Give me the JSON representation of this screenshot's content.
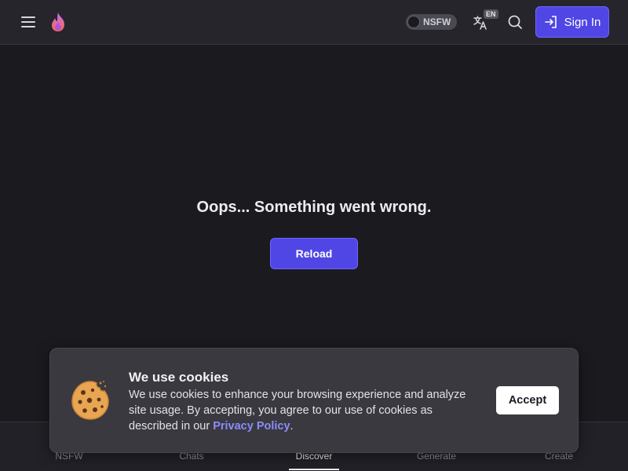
{
  "header": {
    "menu_icon": "hamburger-icon",
    "logo_icon": "flame-icon",
    "nsfw_toggle_label": "NSFW",
    "nsfw_enabled": false,
    "language_badge": "EN",
    "signin_label": "Sign In",
    "colors": {
      "accent": "#4f46e5",
      "background": "#26252b"
    }
  },
  "main": {
    "error_message": "Oops... Something went wrong.",
    "reload_label": "Reload"
  },
  "bottom_nav": {
    "items": [
      {
        "label": "NSFW"
      },
      {
        "label": "Chats"
      },
      {
        "label": "Discover",
        "active": true
      },
      {
        "label": "Generate"
      },
      {
        "label": "Create"
      }
    ]
  },
  "cookie_banner": {
    "title": "We use cookies",
    "text_before_link": "We use cookies to enhance your browsing experience and analyze site usage. By accepting, you agree to our use of cookies as described in our ",
    "link_text": "Privacy Policy",
    "text_after_link": ".",
    "accept_label": "Accept",
    "icon": "cookie-icon"
  }
}
